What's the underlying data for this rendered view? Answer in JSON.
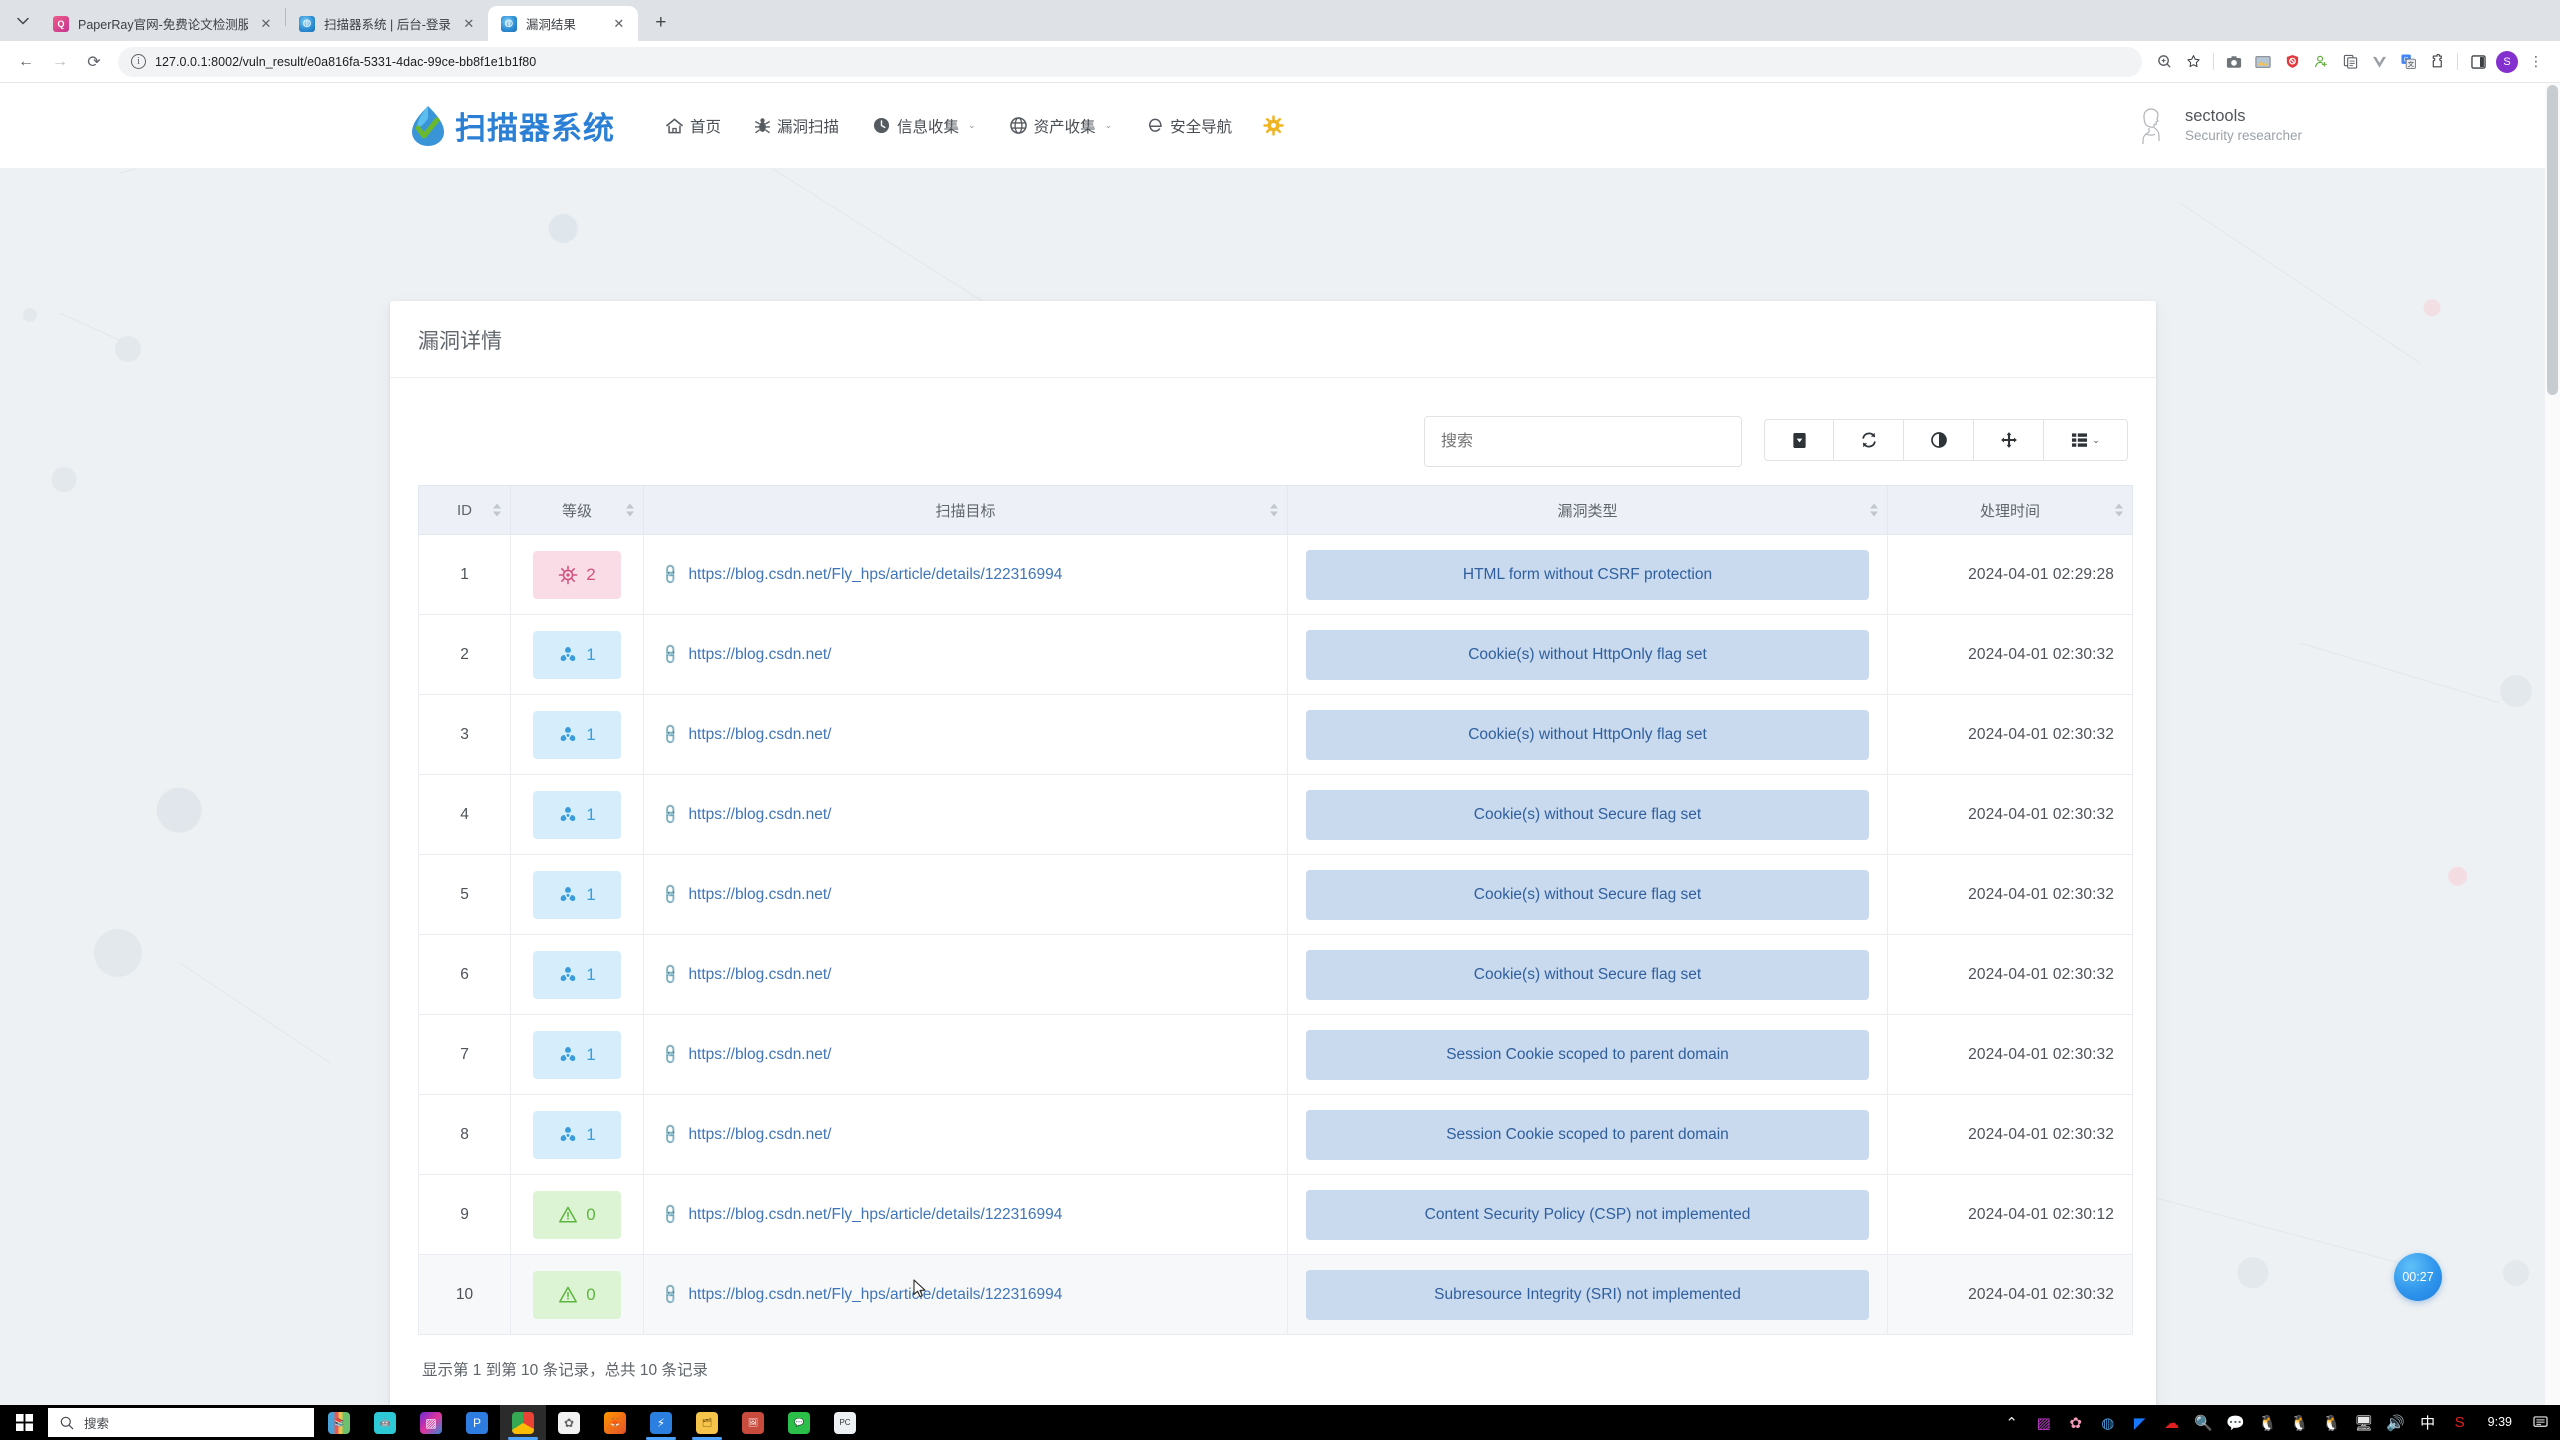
{
  "browser": {
    "tabs": [
      {
        "title": "PaperRay官网-免费论文检测服…",
        "favicon": "paperray-icon",
        "active": false
      },
      {
        "title": "扫描器系统 | 后台-登录",
        "favicon": "scanner-icon",
        "active": false
      },
      {
        "title": "漏洞结果",
        "favicon": "scanner-icon",
        "active": true
      }
    ],
    "new_tab_label": "+",
    "tab_close_label": "✕",
    "tab_list_label": "⌄",
    "nav": {
      "back": "←",
      "forward": "→",
      "reload": "⟳"
    },
    "url": "127.0.0.1:8002/vuln_result/e0a816fa-5331-4dac-99ce-bb8f1e1b1f80",
    "site_info_label": "ⓘ",
    "omni_icons": [
      "zoom-icon",
      "bookmark-star-icon",
      "screenshot-icon",
      "image-icon",
      "adblock-shield-icon",
      "user-script-icon",
      "copy-icon",
      "vimium-icon",
      "google-translate-icon",
      "extensions-puzzle-icon",
      "side-panel-icon"
    ],
    "profile_initial": "S",
    "menu_label": "⋮"
  },
  "site": {
    "brand": "扫描器系统",
    "nav_items": [
      {
        "label": "首页",
        "icon": "home-icon",
        "caret": false
      },
      {
        "label": "漏洞扫描",
        "icon": "bug-icon",
        "caret": false
      },
      {
        "label": "信息收集",
        "icon": "globe-clock-icon",
        "caret": true
      },
      {
        "label": "资产收集",
        "icon": "globe-icon",
        "caret": true
      },
      {
        "label": "安全导航",
        "icon": "compass-e-icon",
        "caret": false
      }
    ],
    "settings_icon": "gear-icon",
    "caret_glyph": "⌄",
    "user": {
      "name": "sectools",
      "role": "Security researcher",
      "avatar_icon": "user-avatar-icon"
    }
  },
  "card": {
    "title": "漏洞详情"
  },
  "toolbar": {
    "search_placeholder": "搜索",
    "search_value": "",
    "buttons": [
      {
        "name": "export-button",
        "icon": "caret-square-down-icon"
      },
      {
        "name": "refresh-button",
        "icon": "refresh-icon"
      },
      {
        "name": "toggle-contrast-button",
        "icon": "half-circle-icon"
      },
      {
        "name": "fullscreen-button",
        "icon": "arrows-move-icon"
      },
      {
        "name": "columns-button",
        "icon": "columns-list-icon"
      }
    ]
  },
  "table": {
    "columns": [
      {
        "key": "id",
        "label": "ID",
        "sortable": true
      },
      {
        "key": "level",
        "label": "等级",
        "sortable": true
      },
      {
        "key": "target",
        "label": "扫描目标",
        "sortable": true
      },
      {
        "key": "type",
        "label": "漏洞类型",
        "sortable": true
      },
      {
        "key": "time",
        "label": "处理时间",
        "sortable": true
      }
    ],
    "rows": [
      {
        "id": "1",
        "level": "2",
        "level_class": "lvl-high",
        "level_icon": "virus-icon",
        "target": "https://blog.csdn.net/Fly_hps/article/details/122316994",
        "type": "HTML form without CSRF protection",
        "time": "2024-04-01 02:29:28"
      },
      {
        "id": "2",
        "level": "1",
        "level_class": "lvl-mid",
        "level_icon": "biohazard-icon",
        "target": "https://blog.csdn.net/",
        "type": "Cookie(s) without HttpOnly flag set",
        "time": "2024-04-01 02:30:32"
      },
      {
        "id": "3",
        "level": "1",
        "level_class": "lvl-mid",
        "level_icon": "biohazard-icon",
        "target": "https://blog.csdn.net/",
        "type": "Cookie(s) without HttpOnly flag set",
        "time": "2024-04-01 02:30:32"
      },
      {
        "id": "4",
        "level": "1",
        "level_class": "lvl-mid",
        "level_icon": "biohazard-icon",
        "target": "https://blog.csdn.net/",
        "type": "Cookie(s) without Secure flag set",
        "time": "2024-04-01 02:30:32"
      },
      {
        "id": "5",
        "level": "1",
        "level_class": "lvl-mid",
        "level_icon": "biohazard-icon",
        "target": "https://blog.csdn.net/",
        "type": "Cookie(s) without Secure flag set",
        "time": "2024-04-01 02:30:32"
      },
      {
        "id": "6",
        "level": "1",
        "level_class": "lvl-mid",
        "level_icon": "biohazard-icon",
        "target": "https://blog.csdn.net/",
        "type": "Cookie(s) without Secure flag set",
        "time": "2024-04-01 02:30:32"
      },
      {
        "id": "7",
        "level": "1",
        "level_class": "lvl-mid",
        "level_icon": "biohazard-icon",
        "target": "https://blog.csdn.net/",
        "type": "Session Cookie scoped to parent domain",
        "time": "2024-04-01 02:30:32"
      },
      {
        "id": "8",
        "level": "1",
        "level_class": "lvl-mid",
        "level_icon": "biohazard-icon",
        "target": "https://blog.csdn.net/",
        "type": "Session Cookie scoped to parent domain",
        "time": "2024-04-01 02:30:32"
      },
      {
        "id": "9",
        "level": "0",
        "level_class": "lvl-low",
        "level_icon": "warning-triangle-icon",
        "target": "https://blog.csdn.net/Fly_hps/article/details/122316994",
        "type": "Content Security Policy (CSP) not implemented",
        "time": "2024-04-01 02:30:12"
      },
      {
        "id": "10",
        "level": "0",
        "level_class": "lvl-low",
        "level_icon": "warning-triangle-icon",
        "target": "https://blog.csdn.net/Fly_hps/article/details/122316994",
        "type": "Subresource Integrity (SRI) not implemented",
        "time": "2024-04-01 02:30:32"
      }
    ],
    "footer": "显示第 1 到第 10 条记录，总共 10 条记录"
  },
  "floating_timer": {
    "value": "00:27"
  },
  "taskbar": {
    "start_icon": "windows-start-icon",
    "search_placeholder": "搜索",
    "search_icon": "search-icon",
    "apps": [
      {
        "name": "books-icon",
        "glyph": "📚",
        "running": false,
        "active": false
      },
      {
        "name": "robot-icon",
        "glyph": "🤖",
        "running": false,
        "active": false
      },
      {
        "name": "colorful-app-icon",
        "glyph": "▨",
        "running": false,
        "active": false
      },
      {
        "name": "pinduoduo-icon",
        "glyph": "P",
        "running": false,
        "active": false
      },
      {
        "name": "chrome-icon",
        "glyph": "◉",
        "running": true,
        "active": true
      },
      {
        "name": "white-app-icon",
        "glyph": "✿",
        "running": false,
        "active": false
      },
      {
        "name": "firefox-icon",
        "glyph": "🦊",
        "running": false,
        "active": false
      },
      {
        "name": "thunder-download-icon",
        "glyph": "⚡",
        "running": true,
        "active": false
      },
      {
        "name": "file-explorer-icon",
        "glyph": "🗂",
        "running": true,
        "active": false
      },
      {
        "name": "picture-app-icon",
        "glyph": "🖼",
        "running": false,
        "active": false
      },
      {
        "name": "wechat-icon",
        "glyph": "💬",
        "running": false,
        "active": false
      },
      {
        "name": "pc-manager-icon",
        "glyph": "PC",
        "running": false,
        "active": false
      }
    ],
    "tray": [
      {
        "name": "show-hidden-icons",
        "glyph": "⌃"
      },
      {
        "name": "colorful-tray-icon",
        "glyph": "▨"
      },
      {
        "name": "sakura-tray-icon",
        "glyph": "✿"
      },
      {
        "name": "cloud-sync-icon",
        "glyph": "◍"
      },
      {
        "name": "dingtalk-icon",
        "glyph": "◤"
      },
      {
        "name": "kuaishou-icon",
        "glyph": "☁"
      },
      {
        "name": "everything-search-icon",
        "glyph": "🔍"
      },
      {
        "name": "wechat-tray-icon",
        "glyph": "💬"
      },
      {
        "name": "qq-tray-icon-1",
        "glyph": "🐧"
      },
      {
        "name": "qq-tray-icon-2",
        "glyph": "🐧"
      },
      {
        "name": "qq-tray-icon-3",
        "glyph": "🐧"
      },
      {
        "name": "network-icon",
        "glyph": "🖥"
      },
      {
        "name": "volume-icon",
        "glyph": "🔊"
      },
      {
        "name": "ime-icon",
        "glyph": "中"
      },
      {
        "name": "sogou-ime-icon",
        "glyph": "S"
      }
    ],
    "clock": "9:39",
    "notification_icon": "notifications-icon"
  },
  "colors": {
    "brand": "#2b7fd4",
    "level_high_bg": "#fadce6",
    "level_high_fg": "#d3507f",
    "level_mid_bg": "#d6edfb",
    "level_mid_fg": "#3a9ddb",
    "level_low_bg": "#ddf4d4",
    "level_low_fg": "#5cb53f",
    "type_pill_bg": "#c9daee",
    "type_pill_fg": "#2f5f9e"
  }
}
